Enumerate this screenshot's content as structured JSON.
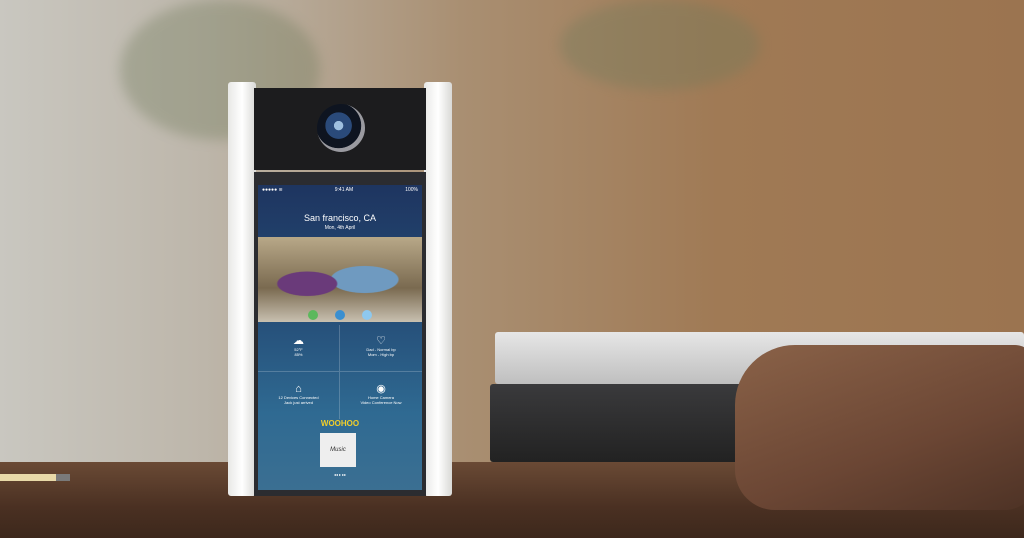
{
  "status_bar": {
    "carrier": "●●●●● ≋",
    "time": "9:41 AM",
    "battery": "100%"
  },
  "location": {
    "city": "San francisco, CA",
    "date": "Mon, 4th April"
  },
  "tiles": [
    {
      "icon": "weather-icon",
      "glyph": "☁",
      "line1": "52°F",
      "line2": "85%"
    },
    {
      "icon": "heart-icon",
      "glyph": "♡",
      "line1": "Dad - Normal bp",
      "line2": "Mom - High bp"
    },
    {
      "icon": "home-icon",
      "glyph": "⌂",
      "line1": "12 Devices Connected",
      "line2": "Jack just arrived"
    },
    {
      "icon": "camera-icon",
      "glyph": "◉",
      "line1": "Home Camera",
      "line2": "Video Conference Now"
    }
  ],
  "app": {
    "logo": "WOOHOO",
    "album_art": "Music",
    "controls": "◂◂  ▸  ▸▸"
  },
  "colors": {
    "logo": "#f2cf2a",
    "screen": "#26507a",
    "call_accept": "#5cb85c"
  }
}
